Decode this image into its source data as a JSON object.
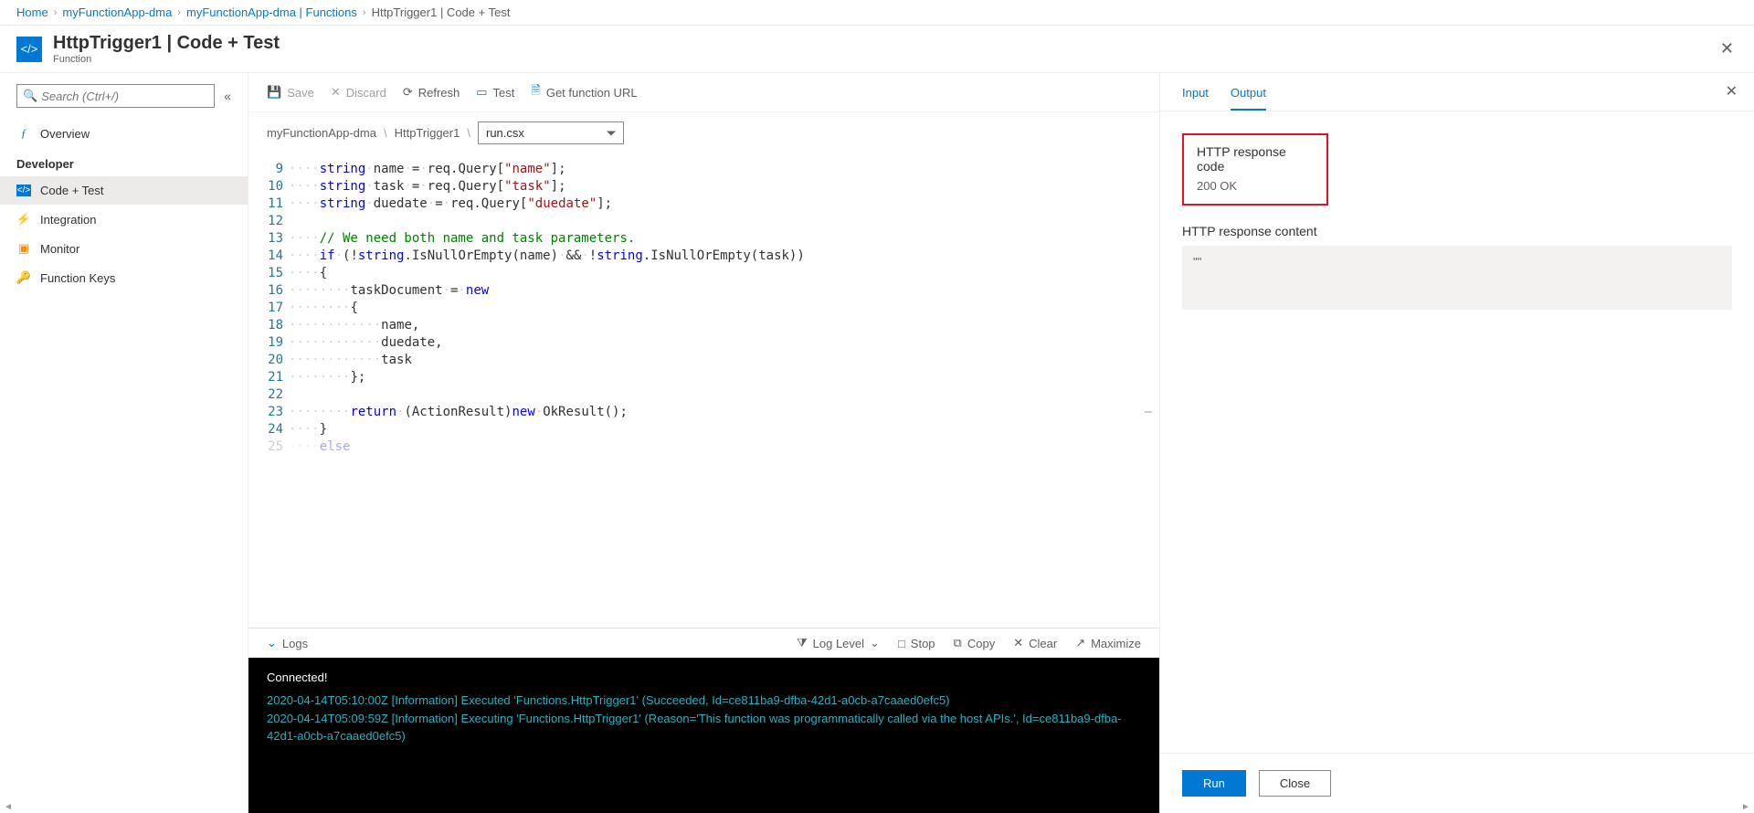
{
  "breadcrumb": {
    "home": "Home",
    "app": "myFunctionApp-dma",
    "functions": "myFunctionApp-dma | Functions",
    "current": "HttpTrigger1 | Code + Test"
  },
  "page": {
    "title": "HttpTrigger1 | Code + Test",
    "subtitle": "Function"
  },
  "search": {
    "placeholder": "Search (Ctrl+/)"
  },
  "sidebar": {
    "overview": "Overview",
    "dev_header": "Developer",
    "code_test": "Code + Test",
    "integration": "Integration",
    "monitor": "Monitor",
    "function_keys": "Function Keys"
  },
  "toolbar": {
    "save": "Save",
    "discard": "Discard",
    "refresh": "Refresh",
    "test": "Test",
    "get_url": "Get function URL"
  },
  "path": {
    "seg1": "myFunctionApp-dma",
    "seg2": "HttpTrigger1",
    "file": "run.csx"
  },
  "code": {
    "lines": [
      "9",
      "10",
      "11",
      "12",
      "13",
      "14",
      "15",
      "16",
      "17",
      "18",
      "19",
      "20",
      "21",
      "22",
      "23",
      "24",
      "25"
    ]
  },
  "logs": {
    "label": "Logs",
    "loglevel": "Log Level",
    "stop": "Stop",
    "copy": "Copy",
    "clear": "Clear",
    "maximize": "Maximize"
  },
  "console": {
    "connected": "Connected!",
    "line1": "2020-04-14T05:10:00Z   [Information]   Executed 'Functions.HttpTrigger1' (Succeeded, Id=ce811ba9-dfba-42d1-a0cb-a7caaed0efc5)",
    "line2": "2020-04-14T05:09:59Z   [Information]   Executing 'Functions.HttpTrigger1' (Reason='This function was programmatically called via the host APIs.', Id=ce811ba9-dfba-42d1-a0cb-a7caaed0efc5)"
  },
  "right": {
    "input_tab": "Input",
    "output_tab": "Output",
    "resp_code_label": "HTTP response code",
    "resp_code_value": "200 OK",
    "resp_content_label": "HTTP response content",
    "resp_content_value": "\"\"",
    "run": "Run",
    "close": "Close"
  }
}
